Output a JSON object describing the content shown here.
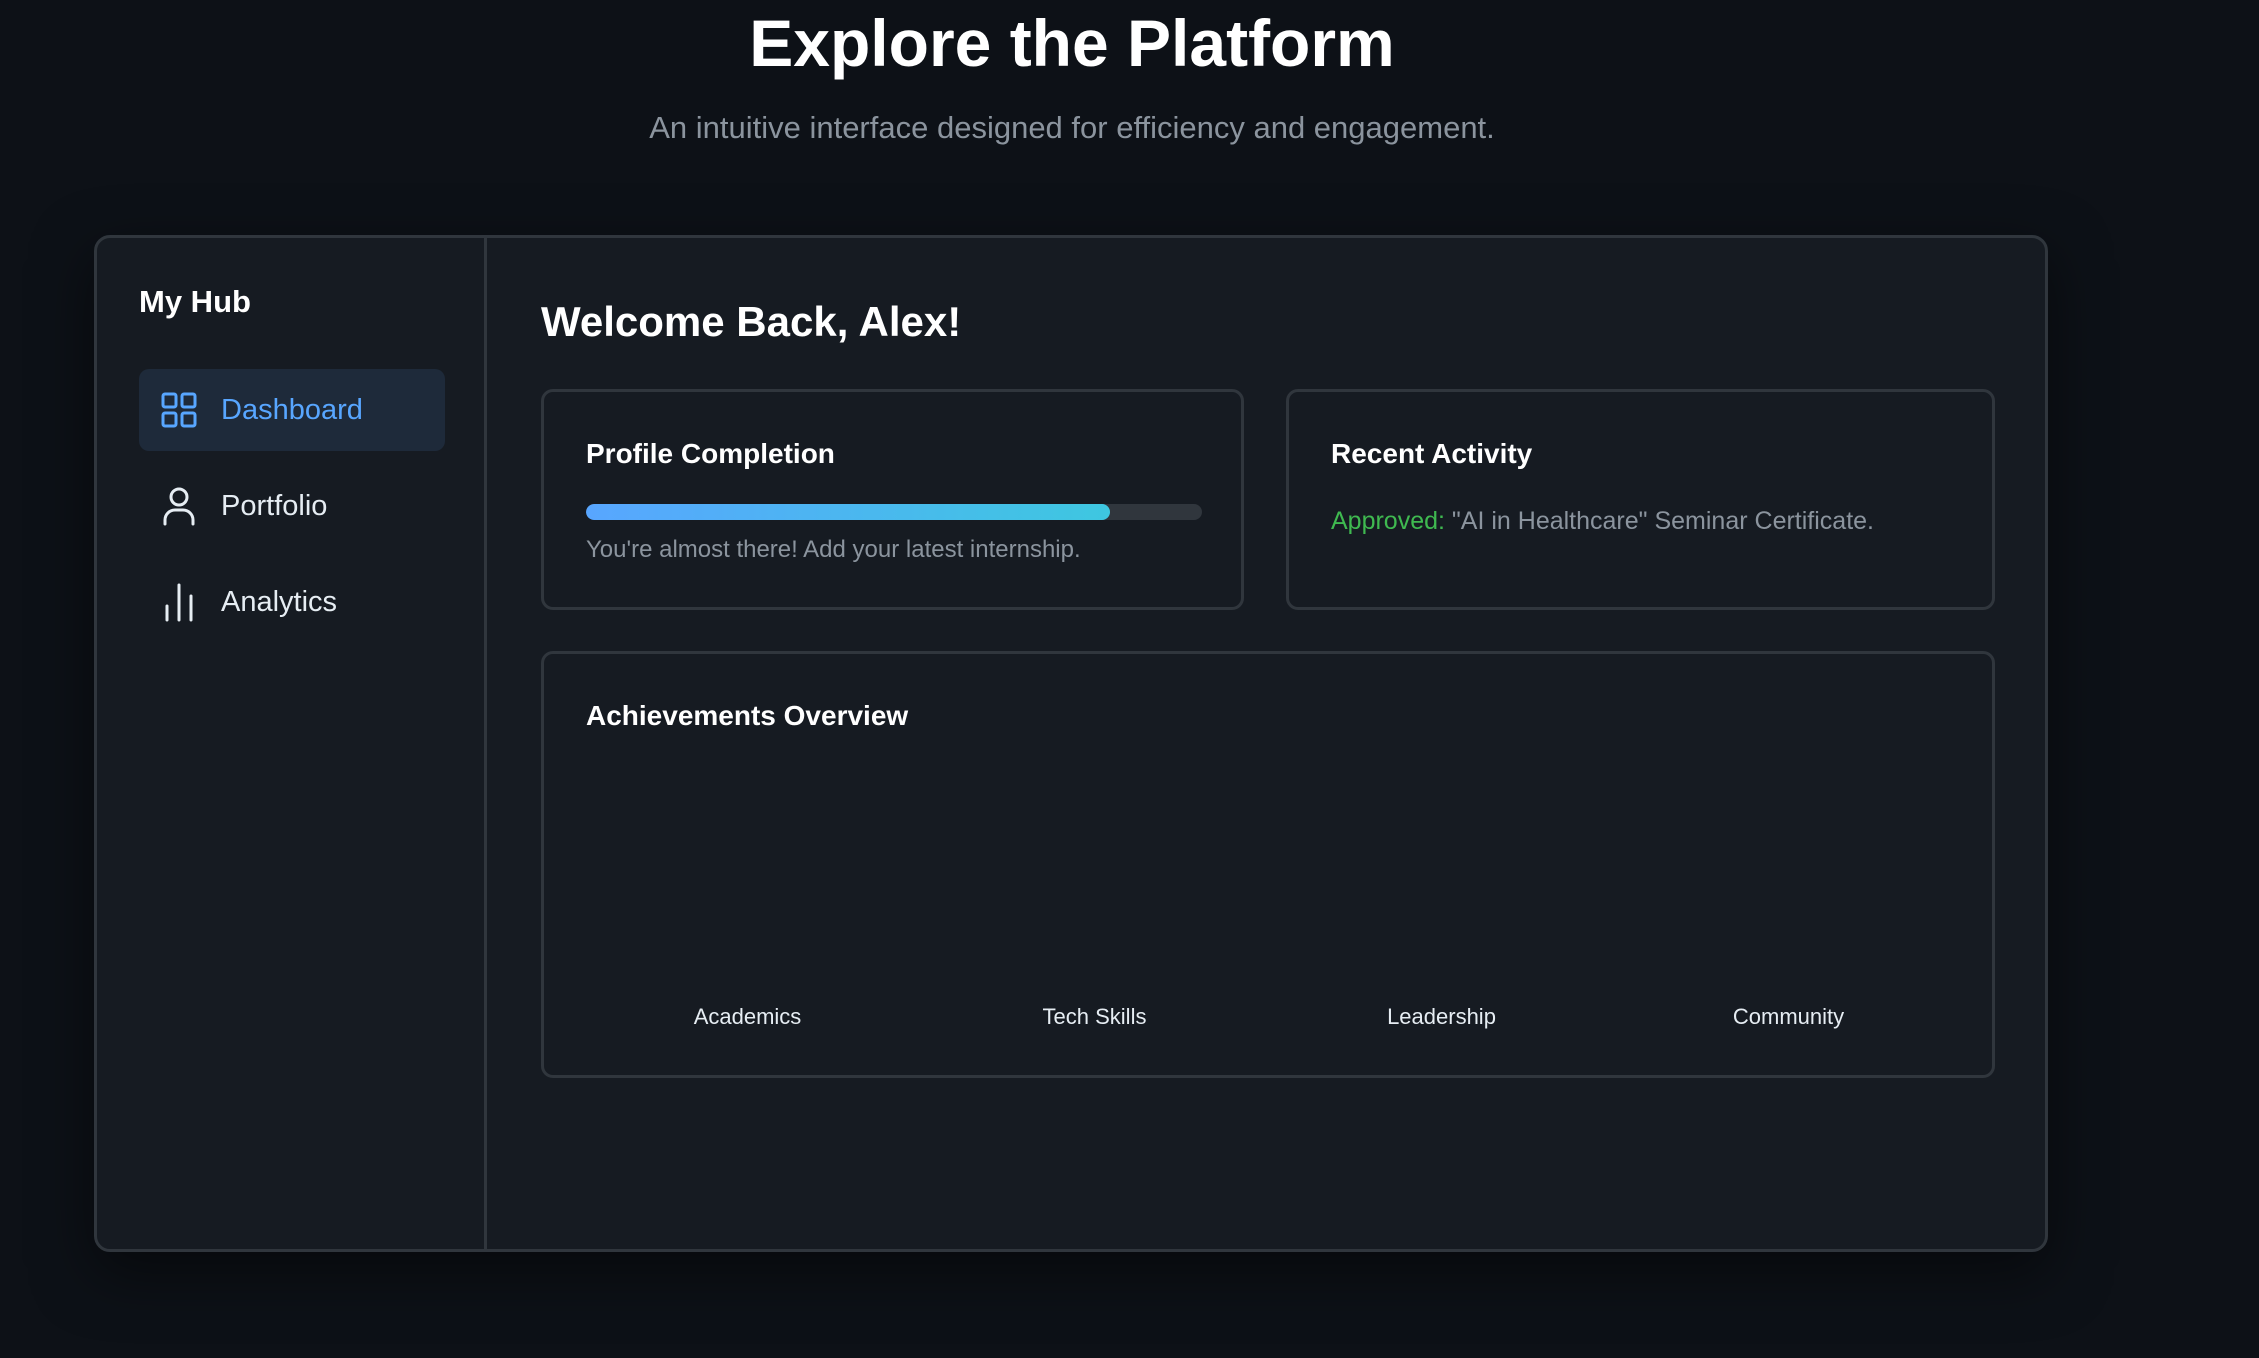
{
  "hero": {
    "title": "Explore the Platform",
    "subtitle": "An intuitive interface designed for efficiency and engagement."
  },
  "sidebar": {
    "title": "My Hub",
    "items": [
      {
        "label": "Dashboard",
        "icon": "grid-icon",
        "active": true
      },
      {
        "label": "Portfolio",
        "icon": "user-icon",
        "active": false
      },
      {
        "label": "Analytics",
        "icon": "bar-chart-icon",
        "active": false
      }
    ]
  },
  "main": {
    "welcome": "Welcome Back, Alex!",
    "profile_card": {
      "title": "Profile Completion",
      "progress": 0.85,
      "note": "You're almost there! Add your latest internship."
    },
    "activity_card": {
      "title": "Recent Activity",
      "status": "Approved:",
      "text": " \"AI in Healthcare\" Seminar Certificate."
    },
    "achievements_card": {
      "title": "Achievements Overview"
    }
  },
  "chart_data": {
    "type": "bar",
    "title": "",
    "categories": [
      "Academics",
      "Tech Skills",
      "Leadership",
      "Community"
    ],
    "values": [],
    "xlabel": "",
    "ylabel": "",
    "grid": false
  },
  "colors": {
    "background": "#0d1117",
    "panel": "#161b22",
    "border": "#30363d",
    "accent": "#58a6ff",
    "accent_gradient_end": "#3ec7e0",
    "success": "#3fb950",
    "muted_text": "#8b949e"
  }
}
